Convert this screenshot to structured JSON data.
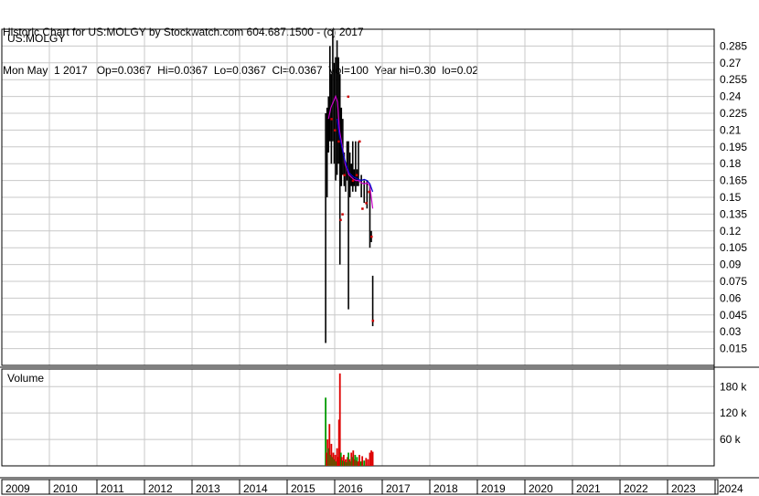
{
  "header": {
    "line1": "Historic Chart for US:MOLGY by Stockwatch.com 604.687.1500 - (c) 2017",
    "line2": "Mon May  1 2017   Op=0.0367  Hi=0.0367  Lo=0.0367  Cl=0.0367  Vol=100  Year hi=0.30  lo=0.02"
  },
  "colors": {
    "price_bar": "#000000",
    "down_marker": "#cc0000",
    "ma_short": "#cc00cc",
    "ma_long": "#0000cc",
    "volume_up": "#009900",
    "volume_down": "#dd0000",
    "grid": "#c8c8c8",
    "border": "#000000"
  },
  "chart_data": [
    {
      "type": "bar",
      "panel": "price",
      "title": "US:MOLGY",
      "ylim": [
        0,
        0.3
      ],
      "yticks": [
        0.015,
        0.03,
        0.045,
        0.06,
        0.075,
        0.09,
        0.105,
        0.12,
        0.135,
        0.15,
        0.165,
        0.18,
        0.195,
        0.21,
        0.225,
        0.24,
        0.255,
        0.27,
        0.285
      ],
      "ytick_labels": [
        "0.015",
        "0.03",
        "0.045",
        "0.06",
        "0.075",
        "0.09",
        "0.105",
        "0.12",
        "0.135",
        "0.15",
        "0.165",
        "0.18",
        "0.195",
        "0.21",
        "0.225",
        "0.24",
        "0.255",
        "0.27",
        "0.285"
      ],
      "x_categories": [
        "2009",
        "2010",
        "2011",
        "2012",
        "2013",
        "2014",
        "2015",
        "2016",
        "2017",
        "2018",
        "2019",
        "2020",
        "2021",
        "2022",
        "2023",
        "2024"
      ],
      "grid": true,
      "series": [
        {
          "kind": "high-low",
          "points": [
            {
              "x": 2015.81,
              "lo": 0.02,
              "hi": 0.225
            },
            {
              "x": 2015.84,
              "lo": 0.15,
              "hi": 0.23
            },
            {
              "x": 2015.87,
              "lo": 0.19,
              "hi": 0.24
            },
            {
              "x": 2015.9,
              "lo": 0.2,
              "hi": 0.285
            },
            {
              "x": 2015.93,
              "lo": 0.18,
              "hi": 0.26
            },
            {
              "x": 2015.96,
              "lo": 0.2,
              "hi": 0.3
            },
            {
              "x": 2015.99,
              "lo": 0.18,
              "hi": 0.27
            },
            {
              "x": 2016.02,
              "lo": 0.165,
              "hi": 0.275
            },
            {
              "x": 2016.05,
              "lo": 0.17,
              "hi": 0.29
            },
            {
              "x": 2016.08,
              "lo": 0.18,
              "hi": 0.275
            },
            {
              "x": 2016.11,
              "lo": 0.09,
              "hi": 0.26
            },
            {
              "x": 2016.14,
              "lo": 0.16,
              "hi": 0.23
            },
            {
              "x": 2016.17,
              "lo": 0.17,
              "hi": 0.22
            },
            {
              "x": 2016.2,
              "lo": 0.16,
              "hi": 0.19
            },
            {
              "x": 2016.23,
              "lo": 0.155,
              "hi": 0.18
            },
            {
              "x": 2016.26,
              "lo": 0.165,
              "hi": 0.2
            },
            {
              "x": 2016.29,
              "lo": 0.05,
              "hi": 0.2
            },
            {
              "x": 2016.32,
              "lo": 0.15,
              "hi": 0.19
            },
            {
              "x": 2016.35,
              "lo": 0.16,
              "hi": 0.18
            },
            {
              "x": 2016.38,
              "lo": 0.155,
              "hi": 0.2
            },
            {
              "x": 2016.41,
              "lo": 0.16,
              "hi": 0.175
            },
            {
              "x": 2016.44,
              "lo": 0.155,
              "hi": 0.2
            },
            {
              "x": 2016.47,
              "lo": 0.16,
              "hi": 0.175
            },
            {
              "x": 2016.5,
              "lo": 0.16,
              "hi": 0.2
            },
            {
              "x": 2016.56,
              "lo": 0.15,
              "hi": 0.17
            },
            {
              "x": 2016.62,
              "lo": 0.145,
              "hi": 0.165
            },
            {
              "x": 2016.68,
              "lo": 0.14,
              "hi": 0.165
            },
            {
              "x": 2016.74,
              "lo": 0.105,
              "hi": 0.16
            },
            {
              "x": 2016.77,
              "lo": 0.11,
              "hi": 0.12
            },
            {
              "x": 2016.8,
              "lo": 0.035,
              "hi": 0.08
            }
          ]
        },
        {
          "kind": "line",
          "color_key": "ma_short",
          "points": [
            [
              2015.87,
              0.22
            ],
            [
              2015.92,
              0.23
            ],
            [
              2015.97,
              0.235
            ],
            [
              2016.02,
              0.24
            ],
            [
              2016.06,
              0.235
            ],
            [
              2016.1,
              0.21
            ],
            [
              2016.14,
              0.2
            ],
            [
              2016.18,
              0.19
            ],
            [
              2016.22,
              0.18
            ],
            [
              2016.26,
              0.175
            ],
            [
              2016.3,
              0.17
            ],
            [
              2016.35,
              0.168
            ],
            [
              2016.4,
              0.166
            ],
            [
              2016.45,
              0.165
            ],
            [
              2016.5,
              0.165
            ],
            [
              2016.56,
              0.163
            ],
            [
              2016.62,
              0.162
            ],
            [
              2016.68,
              0.163
            ],
            [
              2016.74,
              0.16
            ],
            [
              2016.8,
              0.14
            ]
          ]
        },
        {
          "kind": "line",
          "color_key": "ma_long",
          "points": [
            [
              2016.05,
              0.22
            ],
            [
              2016.1,
              0.205
            ],
            [
              2016.15,
              0.195
            ],
            [
              2016.2,
              0.185
            ],
            [
              2016.25,
              0.178
            ],
            [
              2016.3,
              0.172
            ],
            [
              2016.35,
              0.17
            ],
            [
              2016.4,
              0.168
            ],
            [
              2016.45,
              0.167
            ],
            [
              2016.5,
              0.166
            ],
            [
              2016.56,
              0.165
            ],
            [
              2016.62,
              0.166
            ],
            [
              2016.68,
              0.165
            ],
            [
              2016.74,
              0.162
            ],
            [
              2016.8,
              0.155
            ]
          ]
        },
        {
          "kind": "markers",
          "color_key": "down_marker",
          "points": [
            [
              2015.93,
              0.22
            ],
            [
              2016.0,
              0.21
            ],
            [
              2016.08,
              0.2
            ],
            [
              2016.12,
              0.13
            ],
            [
              2016.16,
              0.135
            ],
            [
              2016.2,
              0.17
            ],
            [
              2016.28,
              0.24
            ],
            [
              2016.38,
              0.165
            ],
            [
              2016.46,
              0.17
            ],
            [
              2016.52,
              0.2
            ],
            [
              2016.58,
              0.14
            ],
            [
              2016.66,
              0.145
            ],
            [
              2016.72,
              0.155
            ],
            [
              2016.77,
              0.115
            ],
            [
              2016.8,
              0.04
            ]
          ]
        }
      ]
    },
    {
      "type": "bar",
      "panel": "volume",
      "title": "Volume",
      "ylim": [
        0,
        220000
      ],
      "yticks": [
        60000,
        120000,
        180000
      ],
      "ytick_labels": [
        "60 k",
        "120 k",
        "180 k"
      ],
      "grid": true,
      "series": [
        {
          "name": "",
          "points": [
            {
              "x": 2015.81,
              "v": 155000,
              "dir": "up"
            },
            {
              "x": 2015.83,
              "v": 30000,
              "dir": "down"
            },
            {
              "x": 2015.85,
              "v": 60000,
              "dir": "down"
            },
            {
              "x": 2015.87,
              "v": 40000,
              "dir": "up"
            },
            {
              "x": 2015.89,
              "v": 95000,
              "dir": "down"
            },
            {
              "x": 2015.91,
              "v": 25000,
              "dir": "up"
            },
            {
              "x": 2015.93,
              "v": 50000,
              "dir": "down"
            },
            {
              "x": 2015.95,
              "v": 20000,
              "dir": "up"
            },
            {
              "x": 2015.97,
              "v": 30000,
              "dir": "down"
            },
            {
              "x": 2015.99,
              "v": 15000,
              "dir": "up"
            },
            {
              "x": 2016.01,
              "v": 25000,
              "dir": "down"
            },
            {
              "x": 2016.03,
              "v": 10000,
              "dir": "up"
            },
            {
              "x": 2016.05,
              "v": 40000,
              "dir": "down"
            },
            {
              "x": 2016.07,
              "v": 20000,
              "dir": "down"
            },
            {
              "x": 2016.09,
              "v": 105000,
              "dir": "down"
            },
            {
              "x": 2016.11,
              "v": 210000,
              "dir": "down"
            },
            {
              "x": 2016.13,
              "v": 30000,
              "dir": "up"
            },
            {
              "x": 2016.15,
              "v": 20000,
              "dir": "down"
            },
            {
              "x": 2016.17,
              "v": 12000,
              "dir": "up"
            },
            {
              "x": 2016.19,
              "v": 25000,
              "dir": "down"
            },
            {
              "x": 2016.21,
              "v": 10000,
              "dir": "up"
            },
            {
              "x": 2016.23,
              "v": 15000,
              "dir": "down"
            },
            {
              "x": 2016.25,
              "v": 8000,
              "dir": "up"
            },
            {
              "x": 2016.27,
              "v": 20000,
              "dir": "down"
            },
            {
              "x": 2016.29,
              "v": 30000,
              "dir": "up"
            },
            {
              "x": 2016.31,
              "v": 15000,
              "dir": "down"
            },
            {
              "x": 2016.33,
              "v": 10000,
              "dir": "up"
            },
            {
              "x": 2016.35,
              "v": 30000,
              "dir": "down"
            },
            {
              "x": 2016.37,
              "v": 20000,
              "dir": "up"
            },
            {
              "x": 2016.39,
              "v": 35000,
              "dir": "down"
            },
            {
              "x": 2016.41,
              "v": 15000,
              "dir": "down"
            },
            {
              "x": 2016.43,
              "v": 25000,
              "dir": "up"
            },
            {
              "x": 2016.45,
              "v": 12000,
              "dir": "down"
            },
            {
              "x": 2016.47,
              "v": 20000,
              "dir": "up"
            },
            {
              "x": 2016.49,
              "v": 10000,
              "dir": "down"
            },
            {
              "x": 2016.52,
              "v": 25000,
              "dir": "down"
            },
            {
              "x": 2016.55,
              "v": 10000,
              "dir": "up"
            },
            {
              "x": 2016.58,
              "v": 22000,
              "dir": "down"
            },
            {
              "x": 2016.62,
              "v": 12000,
              "dir": "up"
            },
            {
              "x": 2016.66,
              "v": 18000,
              "dir": "down"
            },
            {
              "x": 2016.7,
              "v": 15000,
              "dir": "down"
            },
            {
              "x": 2016.74,
              "v": 30000,
              "dir": "down"
            },
            {
              "x": 2016.77,
              "v": 35000,
              "dir": "down"
            },
            {
              "x": 2016.8,
              "v": 32000,
              "dir": "down"
            }
          ]
        }
      ]
    }
  ]
}
